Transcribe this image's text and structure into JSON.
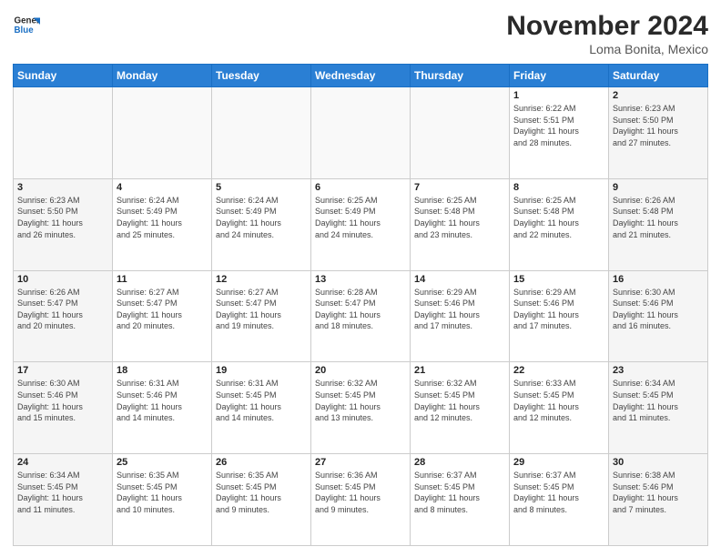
{
  "logo": {
    "line1": "General",
    "line2": "Blue"
  },
  "title": "November 2024",
  "location": "Loma Bonita, Mexico",
  "days_header": [
    "Sunday",
    "Monday",
    "Tuesday",
    "Wednesday",
    "Thursday",
    "Friday",
    "Saturday"
  ],
  "weeks": [
    [
      {
        "day": "",
        "info": ""
      },
      {
        "day": "",
        "info": ""
      },
      {
        "day": "",
        "info": ""
      },
      {
        "day": "",
        "info": ""
      },
      {
        "day": "",
        "info": ""
      },
      {
        "day": "1",
        "info": "Sunrise: 6:22 AM\nSunset: 5:51 PM\nDaylight: 11 hours\nand 28 minutes."
      },
      {
        "day": "2",
        "info": "Sunrise: 6:23 AM\nSunset: 5:50 PM\nDaylight: 11 hours\nand 27 minutes."
      }
    ],
    [
      {
        "day": "3",
        "info": "Sunrise: 6:23 AM\nSunset: 5:50 PM\nDaylight: 11 hours\nand 26 minutes."
      },
      {
        "day": "4",
        "info": "Sunrise: 6:24 AM\nSunset: 5:49 PM\nDaylight: 11 hours\nand 25 minutes."
      },
      {
        "day": "5",
        "info": "Sunrise: 6:24 AM\nSunset: 5:49 PM\nDaylight: 11 hours\nand 24 minutes."
      },
      {
        "day": "6",
        "info": "Sunrise: 6:25 AM\nSunset: 5:49 PM\nDaylight: 11 hours\nand 24 minutes."
      },
      {
        "day": "7",
        "info": "Sunrise: 6:25 AM\nSunset: 5:48 PM\nDaylight: 11 hours\nand 23 minutes."
      },
      {
        "day": "8",
        "info": "Sunrise: 6:25 AM\nSunset: 5:48 PM\nDaylight: 11 hours\nand 22 minutes."
      },
      {
        "day": "9",
        "info": "Sunrise: 6:26 AM\nSunset: 5:48 PM\nDaylight: 11 hours\nand 21 minutes."
      }
    ],
    [
      {
        "day": "10",
        "info": "Sunrise: 6:26 AM\nSunset: 5:47 PM\nDaylight: 11 hours\nand 20 minutes."
      },
      {
        "day": "11",
        "info": "Sunrise: 6:27 AM\nSunset: 5:47 PM\nDaylight: 11 hours\nand 20 minutes."
      },
      {
        "day": "12",
        "info": "Sunrise: 6:27 AM\nSunset: 5:47 PM\nDaylight: 11 hours\nand 19 minutes."
      },
      {
        "day": "13",
        "info": "Sunrise: 6:28 AM\nSunset: 5:47 PM\nDaylight: 11 hours\nand 18 minutes."
      },
      {
        "day": "14",
        "info": "Sunrise: 6:29 AM\nSunset: 5:46 PM\nDaylight: 11 hours\nand 17 minutes."
      },
      {
        "day": "15",
        "info": "Sunrise: 6:29 AM\nSunset: 5:46 PM\nDaylight: 11 hours\nand 17 minutes."
      },
      {
        "day": "16",
        "info": "Sunrise: 6:30 AM\nSunset: 5:46 PM\nDaylight: 11 hours\nand 16 minutes."
      }
    ],
    [
      {
        "day": "17",
        "info": "Sunrise: 6:30 AM\nSunset: 5:46 PM\nDaylight: 11 hours\nand 15 minutes."
      },
      {
        "day": "18",
        "info": "Sunrise: 6:31 AM\nSunset: 5:46 PM\nDaylight: 11 hours\nand 14 minutes."
      },
      {
        "day": "19",
        "info": "Sunrise: 6:31 AM\nSunset: 5:45 PM\nDaylight: 11 hours\nand 14 minutes."
      },
      {
        "day": "20",
        "info": "Sunrise: 6:32 AM\nSunset: 5:45 PM\nDaylight: 11 hours\nand 13 minutes."
      },
      {
        "day": "21",
        "info": "Sunrise: 6:32 AM\nSunset: 5:45 PM\nDaylight: 11 hours\nand 12 minutes."
      },
      {
        "day": "22",
        "info": "Sunrise: 6:33 AM\nSunset: 5:45 PM\nDaylight: 11 hours\nand 12 minutes."
      },
      {
        "day": "23",
        "info": "Sunrise: 6:34 AM\nSunset: 5:45 PM\nDaylight: 11 hours\nand 11 minutes."
      }
    ],
    [
      {
        "day": "24",
        "info": "Sunrise: 6:34 AM\nSunset: 5:45 PM\nDaylight: 11 hours\nand 11 minutes."
      },
      {
        "day": "25",
        "info": "Sunrise: 6:35 AM\nSunset: 5:45 PM\nDaylight: 11 hours\nand 10 minutes."
      },
      {
        "day": "26",
        "info": "Sunrise: 6:35 AM\nSunset: 5:45 PM\nDaylight: 11 hours\nand 9 minutes."
      },
      {
        "day": "27",
        "info": "Sunrise: 6:36 AM\nSunset: 5:45 PM\nDaylight: 11 hours\nand 9 minutes."
      },
      {
        "day": "28",
        "info": "Sunrise: 6:37 AM\nSunset: 5:45 PM\nDaylight: 11 hours\nand 8 minutes."
      },
      {
        "day": "29",
        "info": "Sunrise: 6:37 AM\nSunset: 5:45 PM\nDaylight: 11 hours\nand 8 minutes."
      },
      {
        "day": "30",
        "info": "Sunrise: 6:38 AM\nSunset: 5:46 PM\nDaylight: 11 hours\nand 7 minutes."
      }
    ]
  ]
}
